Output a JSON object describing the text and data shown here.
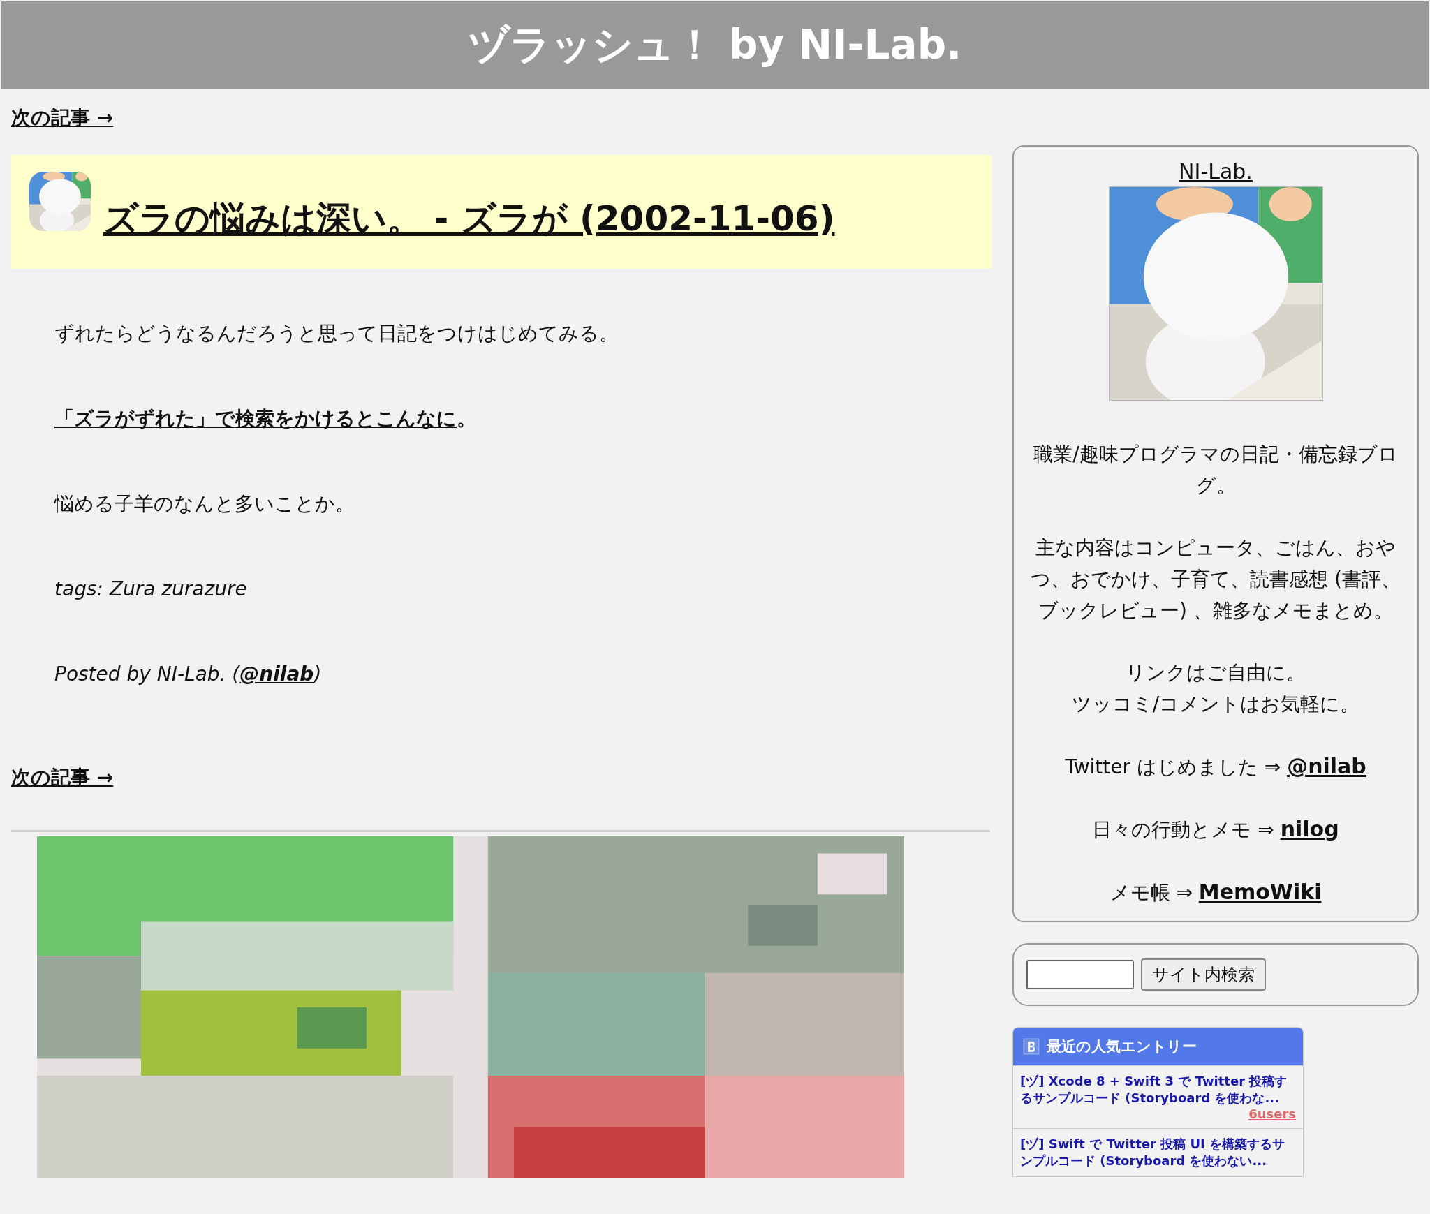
{
  "header": {
    "title": "ヅラッシュ！ by NI-Lab."
  },
  "nav_top": {
    "label": "次の記事 →"
  },
  "article": {
    "title": "ズラの悩みは深い。 - ズラが (2002-11-06)",
    "paragraphs": [
      {
        "kind": "plain",
        "parts": [
          {
            "text": "ずれたらどうなるんだろうと思って日記をつけはじめてみる。",
            "link": false
          }
        ]
      },
      {
        "kind": "bold",
        "parts": [
          {
            "text": "「ズラがずれた」で検索をかけるとこんなに",
            "link": true
          },
          {
            "text": "。",
            "link": false
          }
        ]
      },
      {
        "kind": "plain",
        "parts": [
          {
            "text": "悩める子羊のなんと多いことか。",
            "link": false
          }
        ]
      },
      {
        "kind": "italic",
        "parts": [
          {
            "text": "tags: Zura zurazure",
            "link": false
          }
        ]
      },
      {
        "kind": "italic",
        "parts": [
          {
            "text": "Posted by NI-Lab. (",
            "link": false
          },
          {
            "text": "@nilab",
            "link": true
          },
          {
            "text": ")",
            "link": false
          }
        ]
      }
    ]
  },
  "nav_bottom": {
    "label": "次の記事 →"
  },
  "sidebar": {
    "profile": {
      "name": "NI-Lab.",
      "blocks": [
        {
          "lines": [
            [
              {
                "text": "職業/趣味プログラマの日記・備忘録ブログ。",
                "link": false
              }
            ]
          ]
        },
        {
          "lines": [
            [
              {
                "text": "主な内容はコンピュータ、ごはん、おやつ、おでかけ、子育て、読書感想 (書評、ブックレビュー) 、雑多なメモまとめ。",
                "link": false
              }
            ]
          ]
        },
        {
          "lines": [
            [
              {
                "text": "リンクはご自由に。",
                "link": false
              }
            ],
            [
              {
                "text": "ツッコミ/コメントはお気軽に。",
                "link": false
              }
            ]
          ]
        },
        {
          "lines": [
            [
              {
                "text": "Twitter はじめました ⇒ ",
                "link": false
              },
              {
                "text": "@nilab",
                "link": true
              }
            ]
          ]
        },
        {
          "lines": [
            [
              {
                "text": "日々の行動とメモ ⇒ ",
                "link": false
              },
              {
                "text": "nilog",
                "link": true
              }
            ]
          ]
        },
        {
          "lines": [
            [
              {
                "text": "メモ帳 ⇒ ",
                "link": false
              },
              {
                "text": "MemoWiki",
                "link": true
              }
            ]
          ]
        }
      ]
    },
    "search": {
      "button": "サイト内検索"
    },
    "popular": {
      "title": "最近の人気エントリー",
      "entries": [
        {
          "title": "[ヅ] Xcode 8 + Swift 3 で Twitter 投稿するサンプルコード (Storyboard を使わな...",
          "users": "6users"
        },
        {
          "title": "[ヅ] Swift で Twitter 投稿 UI を構築するサンプルコード (Storyboard を使わない..."
        }
      ]
    }
  }
}
